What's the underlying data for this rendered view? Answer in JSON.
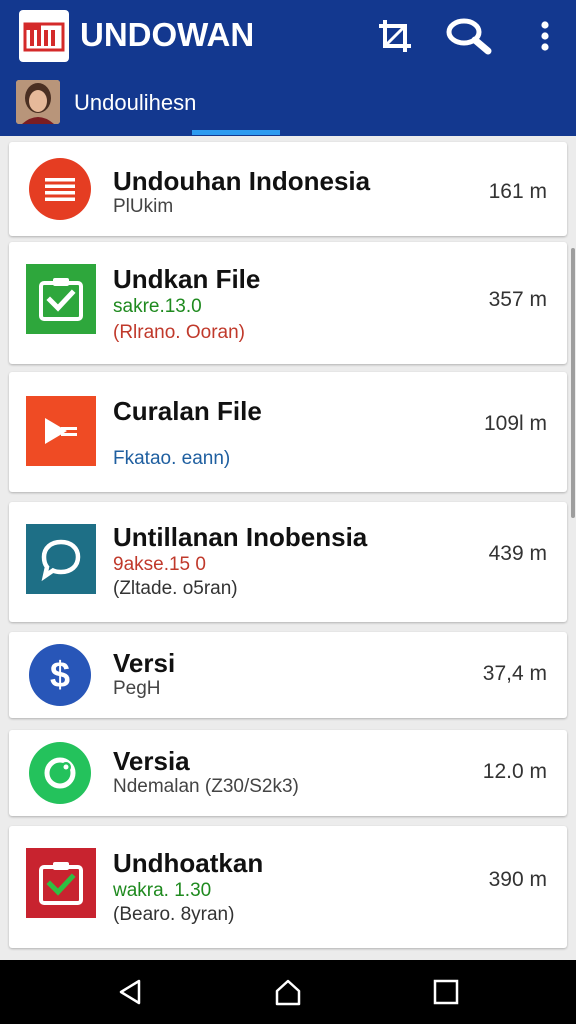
{
  "app": {
    "title": "UNDOWAN"
  },
  "subheader": {
    "title": "Undoulihesn"
  },
  "icons": {
    "logo": "app-logo",
    "actions": [
      "crop-icon",
      "search-icon",
      "more-vert-icon"
    ],
    "nav": [
      "back-icon",
      "home-icon",
      "recents-icon"
    ]
  },
  "colors": {
    "appbar": "#13388f",
    "tab_indicator": "#2d9bf0",
    "green_text": "#1f8a1f",
    "red_text": "#c0392b",
    "blue_text": "#1f5fa0"
  },
  "items": [
    {
      "title": "Undouhan Indonesia",
      "line1": "PlUkim",
      "line2": "",
      "size": "161 m",
      "icon": "list-icon"
    },
    {
      "title": "Undkan File",
      "line1": "sakre.13.0",
      "line2": "(Rlrano. Ooran)",
      "size": "357 m",
      "icon": "checkbox-icon"
    },
    {
      "title": "Curalan File",
      "line1": "",
      "line2": "Fkatao. eann)",
      "size": "109l m",
      "icon": "play-icon"
    },
    {
      "title": "Untillanan Inobensia",
      "line1": "9akse.15 0",
      "line2": "(Zltade. o5ran)",
      "size": "439 m",
      "icon": "chat-icon"
    },
    {
      "title": "Versi",
      "line1": "PegH",
      "line2": "",
      "size": "37,4 m",
      "icon": "dollar-icon"
    },
    {
      "title": "Versia",
      "line1": "Ndemalan (Z30/S2k3)",
      "line2": "",
      "size": "12.0 m",
      "icon": "phone-icon"
    },
    {
      "title": "Undhoatkan",
      "line1": "wakra. 1.30",
      "line2": "(Bearo. 8yran)",
      "size": "390 m",
      "icon": "checkbox-icon"
    }
  ]
}
